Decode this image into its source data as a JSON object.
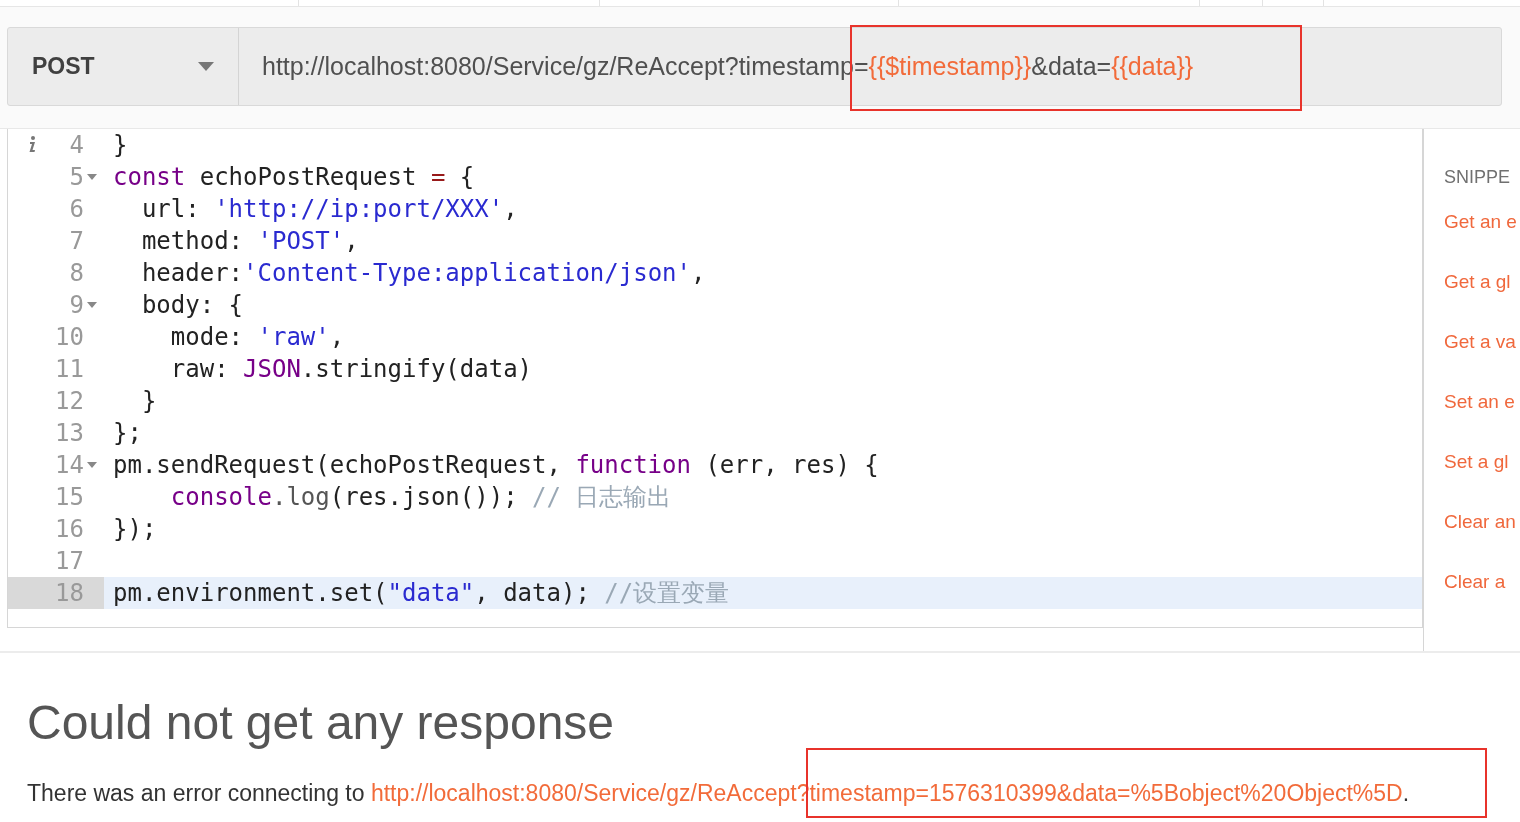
{
  "request": {
    "method": "POST",
    "annotated": true,
    "url": [
      {
        "text": "http://localhost:8080/Service/gz/ReAccept?timestamp=",
        "kind": "plain"
      },
      {
        "text": "{{$timestamp}}",
        "kind": "variable"
      },
      {
        "text": "&data=",
        "kind": "plain"
      },
      {
        "text": "{{data}}",
        "kind": "variable"
      }
    ]
  },
  "editor": {
    "lines": [
      {
        "number": "4",
        "info": true,
        "foldable": false,
        "active": false,
        "tokens": [
          {
            "text": "}",
            "kind": "plain"
          }
        ]
      },
      {
        "number": "5",
        "info": false,
        "foldable": true,
        "active": false,
        "tokens": [
          {
            "text": "const",
            "kind": "keyword"
          },
          {
            "text": " echoPostRequest ",
            "kind": "plain"
          },
          {
            "text": "=",
            "kind": "operator"
          },
          {
            "text": " {",
            "kind": "plain"
          }
        ]
      },
      {
        "number": "6",
        "info": false,
        "foldable": false,
        "active": false,
        "tokens": [
          {
            "text": "  url: ",
            "kind": "plain"
          },
          {
            "text": "'http://ip:port/XXX'",
            "kind": "string"
          },
          {
            "text": ",",
            "kind": "plain"
          }
        ]
      },
      {
        "number": "7",
        "info": false,
        "foldable": false,
        "active": false,
        "tokens": [
          {
            "text": "  method: ",
            "kind": "plain"
          },
          {
            "text": "'POST'",
            "kind": "string"
          },
          {
            "text": ",",
            "kind": "plain"
          }
        ]
      },
      {
        "number": "8",
        "info": false,
        "foldable": false,
        "active": false,
        "tokens": [
          {
            "text": "  header:",
            "kind": "plain"
          },
          {
            "text": "'Content-Type:application/json'",
            "kind": "string"
          },
          {
            "text": ",",
            "kind": "plain"
          }
        ]
      },
      {
        "number": "9",
        "info": false,
        "foldable": true,
        "active": false,
        "tokens": [
          {
            "text": "  body: {",
            "kind": "plain"
          }
        ]
      },
      {
        "number": "10",
        "info": false,
        "foldable": false,
        "active": false,
        "tokens": [
          {
            "text": "    mode: ",
            "kind": "plain"
          },
          {
            "text": "'raw'",
            "kind": "string"
          },
          {
            "text": ",",
            "kind": "plain"
          }
        ]
      },
      {
        "number": "11",
        "info": false,
        "foldable": false,
        "active": false,
        "tokens": [
          {
            "text": "    raw: ",
            "kind": "plain"
          },
          {
            "text": "JSON",
            "kind": "builtin"
          },
          {
            "text": ".stringify(data)",
            "kind": "plain"
          }
        ]
      },
      {
        "number": "12",
        "info": false,
        "foldable": false,
        "active": false,
        "tokens": [
          {
            "text": "  }",
            "kind": "plain"
          }
        ]
      },
      {
        "number": "13",
        "info": false,
        "foldable": false,
        "active": false,
        "tokens": [
          {
            "text": "};",
            "kind": "plain"
          }
        ]
      },
      {
        "number": "14",
        "info": false,
        "foldable": true,
        "active": false,
        "tokens": [
          {
            "text": "pm.sendRequest(echoPostRequest, ",
            "kind": "plain"
          },
          {
            "text": "function",
            "kind": "keyword"
          },
          {
            "text": " (err, res) {",
            "kind": "plain"
          }
        ]
      },
      {
        "number": "15",
        "info": false,
        "foldable": false,
        "active": false,
        "tokens": [
          {
            "text": "    console",
            "kind": "builtin"
          },
          {
            "text": ".log",
            "kind": "property"
          },
          {
            "text": "(res.json()); ",
            "kind": "plain"
          },
          {
            "text": "// 日志输出",
            "kind": "comment"
          }
        ]
      },
      {
        "number": "16",
        "info": false,
        "foldable": false,
        "active": false,
        "tokens": [
          {
            "text": "});",
            "kind": "plain"
          }
        ]
      },
      {
        "number": "17",
        "info": false,
        "foldable": false,
        "active": false
      },
      {
        "number": "18",
        "info": false,
        "foldable": false,
        "active": true,
        "tokens": [
          {
            "text": "pm.environment.set(",
            "kind": "plain"
          },
          {
            "text": "\"data\"",
            "kind": "string"
          },
          {
            "text": ", data); ",
            "kind": "plain"
          },
          {
            "text": "//设置变量",
            "kind": "comment"
          }
        ]
      }
    ]
  },
  "snippets": {
    "title": "SNIPPE",
    "items": [
      "Get an e",
      "Get a gl",
      "Get a va",
      "Set an e",
      "Set a gl",
      "Clear an",
      "Clear a"
    ]
  },
  "response": {
    "title": "Could not get any response",
    "annotated": true,
    "prefix": "There was an error connecting to ",
    "link": "http://localhost:8080/Service/gz/ReAccept?timestamp=1576310399&data=%5Bobject%20Object%5D",
    "suffix": "."
  }
}
